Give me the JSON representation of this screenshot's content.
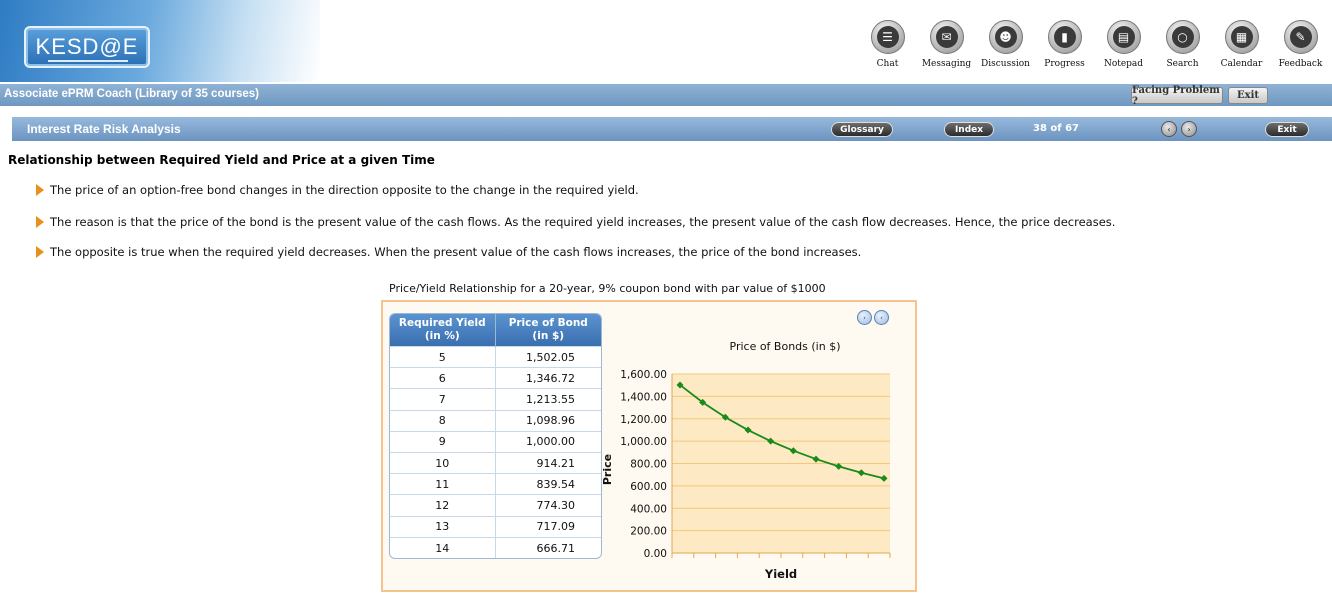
{
  "app": {
    "logo_text": "KESD@E",
    "toolbar": [
      {
        "label": "Chat",
        "icon": "chat-icon",
        "glyph": "☰"
      },
      {
        "label": "Messaging",
        "icon": "envelope-icon",
        "glyph": "✉"
      },
      {
        "label": "Discussion",
        "icon": "people-icon",
        "glyph": "☻"
      },
      {
        "label": "Progress",
        "icon": "bar-chart-icon",
        "glyph": "▮"
      },
      {
        "label": "Notepad",
        "icon": "notepad-icon",
        "glyph": "▤"
      },
      {
        "label": "Search",
        "icon": "search-icon",
        "glyph": "○"
      },
      {
        "label": "Calendar",
        "icon": "calendar-icon",
        "glyph": "▦"
      },
      {
        "label": "Feedback",
        "icon": "feedback-icon",
        "glyph": "✎"
      }
    ]
  },
  "course_bar": {
    "title": "Associate ePRM Coach (Library of 35 courses)",
    "facing_problem": "Facing Problem ?",
    "exit": "Exit"
  },
  "lesson_bar": {
    "title": "Interest Rate Risk Analysis",
    "glossary": "Glossary",
    "index": "Index",
    "page": "38 of 67",
    "prev_glyph": "‹",
    "next_glyph": "›",
    "exit": "Exit"
  },
  "content": {
    "heading": "Relationship between Required Yield and Price at a given Time",
    "bullets": [
      "The price of an option-free bond changes in the direction opposite to the change in the required yield.",
      "The reason is that the price of the bond is the present value of the cash flows. As the required yield increases, the present value of the cash flow decreases. Hence, the price decreases.",
      "The opposite is true when the required yield decreases. When the present value of the cash flows increases, the price of the bond increases."
    ],
    "caption": "Price/Yield Relationship for a 20-year, 9% coupon bond with par value of $1000",
    "chart_nav_prev": "‹",
    "chart_nav_next": "›"
  },
  "table": {
    "headers": [
      "Required Yield (in %)",
      "Price of Bond (in $)"
    ],
    "header_lines": [
      [
        "Required Yield",
        "(in %)"
      ],
      [
        "Price of Bond",
        "(in $)"
      ]
    ],
    "rows": [
      [
        "5",
        "1,502.05"
      ],
      [
        "6",
        "1,346.72"
      ],
      [
        "7",
        "1,213.55"
      ],
      [
        "8",
        "1,098.96"
      ],
      [
        "9",
        "1,000.00"
      ],
      [
        "10",
        "914.21"
      ],
      [
        "11",
        "839.54"
      ],
      [
        "12",
        "774.30"
      ],
      [
        "13",
        "717.09"
      ],
      [
        "14",
        "666.71"
      ]
    ]
  },
  "chart_data": {
    "type": "line",
    "title": "Price of Bonds (in $)",
    "xlabel": "Yield",
    "ylabel": "Price",
    "x": [
      5,
      6,
      7,
      8,
      9,
      10,
      11,
      12,
      13,
      14
    ],
    "series": [
      {
        "values": [
          1502.05,
          1346.72,
          1213.55,
          1098.96,
          1000.0,
          914.21,
          839.54,
          774.3,
          717.09,
          666.71
        ]
      }
    ],
    "ylim": [
      0,
      1600
    ],
    "yticks": [
      "0.00",
      "200.00",
      "400.00",
      "600.00",
      "800.00",
      "1,000.00",
      "1,200.00",
      "1,400.00",
      "1,600.00"
    ],
    "grid": true,
    "colors": {
      "line": "#1a8a1a",
      "plot_bg": "#fde9c4",
      "grid": "#f2c97a"
    }
  }
}
